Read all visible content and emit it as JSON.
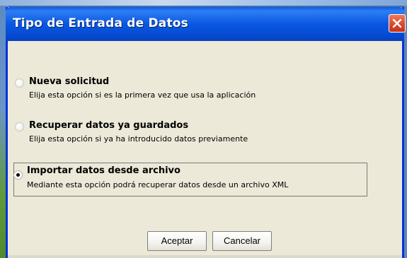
{
  "window": {
    "title": "Tipo de Entrada de Datos"
  },
  "options": [
    {
      "title": "Nueva solicitud",
      "description": "Elija esta opción si es la primera vez que usa la aplicación",
      "selected": false
    },
    {
      "title": "Recuperar datos ya guardados",
      "description": "Elija esta opción si ya ha introducido datos previamente",
      "selected": false
    },
    {
      "title": "Importar datos desde archivo",
      "description": "Mediante esta opción podrá recuperar datos desde un archivo XML",
      "selected": true
    }
  ],
  "buttons": {
    "accept_label": "Aceptar",
    "cancel_label": "Cancelar"
  },
  "colors": {
    "titlebar": "#0a58e0",
    "dialog_bg": "#ece9d8",
    "close_button": "#d9442a"
  },
  "icons": {
    "close": "close-icon",
    "radio_off": "radio-unchecked-icon",
    "radio_on": "radio-checked-icon"
  }
}
